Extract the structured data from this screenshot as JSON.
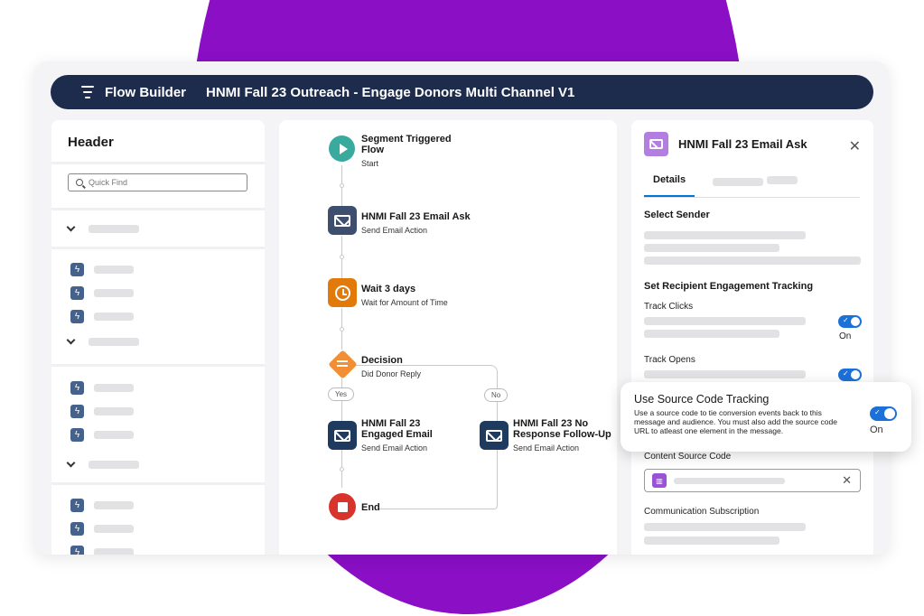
{
  "app_title": "Flow Builder",
  "flow_title": "HNMI Fall 23 Outreach - Engage Donors Multi Channel V1",
  "left_panel": {
    "header": "Header",
    "search_placeholder": "Quick Find"
  },
  "canvas": {
    "nodes": [
      {
        "name": "Segment Triggered Flow",
        "sub": "Start",
        "icon": "play-icon",
        "color": "#3aaa9f"
      },
      {
        "name": "HNMI Fall 23 Email Ask",
        "sub": "Send Email Action",
        "icon": "envelope-icon",
        "color": "#3d4e6f"
      },
      {
        "name": "Wait 3 days",
        "sub": "Wait for Amount of Time",
        "icon": "clock-icon",
        "color": "#e2790b"
      },
      {
        "name": "Decision",
        "sub": "Did Donor Reply",
        "icon": "decision-icon",
        "color": "#f28f35"
      },
      {
        "name": "HNMI Fall 23 Engaged Email",
        "sub": "Send Email Action",
        "icon": "envelope-icon",
        "color": "#1e3a5f"
      },
      {
        "name": "HNMI Fall 23 No Response Follow-Up",
        "sub": "Send Email Action",
        "icon": "envelope-icon",
        "color": "#1e3a5f"
      },
      {
        "name": "End",
        "sub": "",
        "icon": "stop-icon",
        "color": "#d8342d"
      }
    ],
    "branch_yes": "Yes",
    "branch_no": "No"
  },
  "right_panel": {
    "title": "HNMI Fall 23 Email Ask",
    "tab_details": "Details",
    "select_sender": "Select Sender",
    "engagement_heading": "Set Recipient Engagement Tracking",
    "track_clicks": "Track Clicks",
    "track_opens": "Track Opens",
    "on_label": "On",
    "content_source_code": "Content Source Code",
    "communication_subscription": "Communication Subscription"
  },
  "popover": {
    "title": "Use Source Code Tracking",
    "body": "Use a source code to tie conversion events back to this message and audience. You must also add the source code URL to atleast one element in the message.",
    "state": "On"
  }
}
